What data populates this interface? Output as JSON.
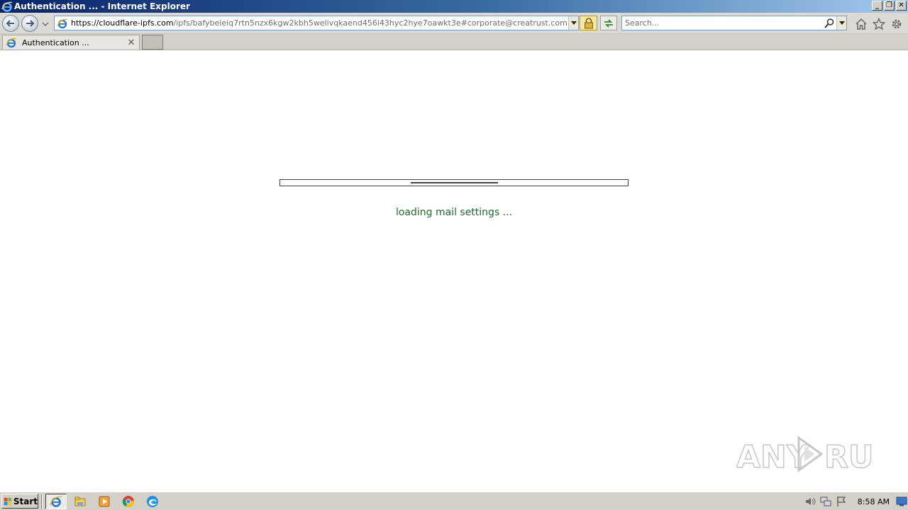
{
  "window": {
    "title": "Authentication ... - Internet Explorer",
    "buttons": {
      "minimize": "_",
      "restore": "❐",
      "close": "✕"
    }
  },
  "navigation": {
    "url_domain": "https://cloudflare-ipfs.com",
    "url_rest": "/ipfs/bafybeieiq7rtn5nzx6kgw2kbh5welivqkaend456i43hyc2hye7oawkt3e#corporate@creatrust.com",
    "search_placeholder": "Search..."
  },
  "tabs": [
    {
      "label": "Authentication ...",
      "close": "✕"
    }
  ],
  "content": {
    "loading_text": "loading mail settings ...",
    "progress_fraction": 0.25
  },
  "taskbar": {
    "start_label": "Start",
    "apps": [
      "ie-icon",
      "explorer-icon",
      "media-player-icon",
      "chrome-icon",
      "edge-icon"
    ],
    "clock": "8:58 AM"
  },
  "watermark": {
    "text": "ANY RUN"
  },
  "colors": {
    "loading_text": "#1f6b2a",
    "titlebar_start": "#0a246a",
    "titlebar_end": "#a6caf0"
  }
}
